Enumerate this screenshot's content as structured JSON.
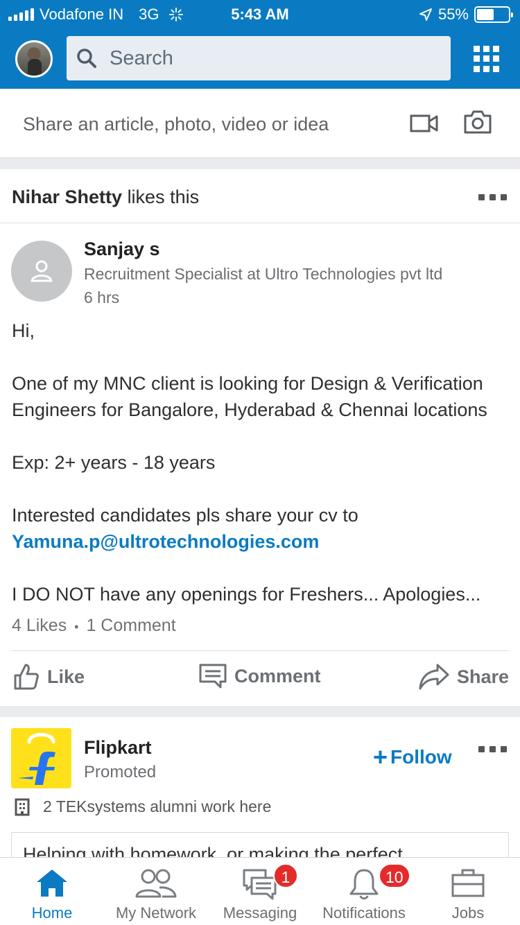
{
  "status_bar": {
    "carrier": "Vodafone IN",
    "network": "3G",
    "time": "5:43 AM",
    "battery_text": "55%",
    "battery_level": 0.55
  },
  "header": {
    "search_placeholder": "Search"
  },
  "share_box": {
    "prompt": "Share an article, photo, video or idea"
  },
  "post": {
    "liked_by": "Nihar Shetty",
    "liked_text": "likes this",
    "author": {
      "name": "Sanjay s",
      "title": "Recruitment Specialist at Ultro Technologies pvt ltd",
      "time": "6 hrs"
    },
    "body": {
      "greeting": "Hi,",
      "para1_line1": "One of my MNC client is looking for Design & Verification",
      "para1_line2": "Engineers for Bangalore, Hyderabad & Chennai locations",
      "experience": "Exp: 2+ years - 18 years",
      "cta": "Interested candidates pls share your cv to",
      "email": "Yamuna.p@ultrotechnologies.com",
      "note": "I DO NOT have any openings for Freshers... Apologies..."
    },
    "stats": {
      "likes": "4 Likes",
      "separator": "•",
      "comments": "1 Comment"
    },
    "actions": {
      "like": "Like",
      "comment": "Comment",
      "share": "Share"
    }
  },
  "promoted": {
    "company": "Flipkart",
    "label": "Promoted",
    "follow": "Follow",
    "alumni": "2 TEKsystems alumni work here",
    "teaser": "Helping with homework, or making the perfect"
  },
  "tabs": [
    {
      "label": "Home",
      "active": true
    },
    {
      "label": "My Network"
    },
    {
      "label": "Messaging",
      "badge": "1"
    },
    {
      "label": "Notifications",
      "badge": "10"
    },
    {
      "label": "Jobs"
    }
  ],
  "colors": {
    "brand": "#0a7bc2",
    "badge": "#e32b2b",
    "flipkart_yellow": "#ffe11b",
    "flipkart_blue": "#2874f0"
  }
}
